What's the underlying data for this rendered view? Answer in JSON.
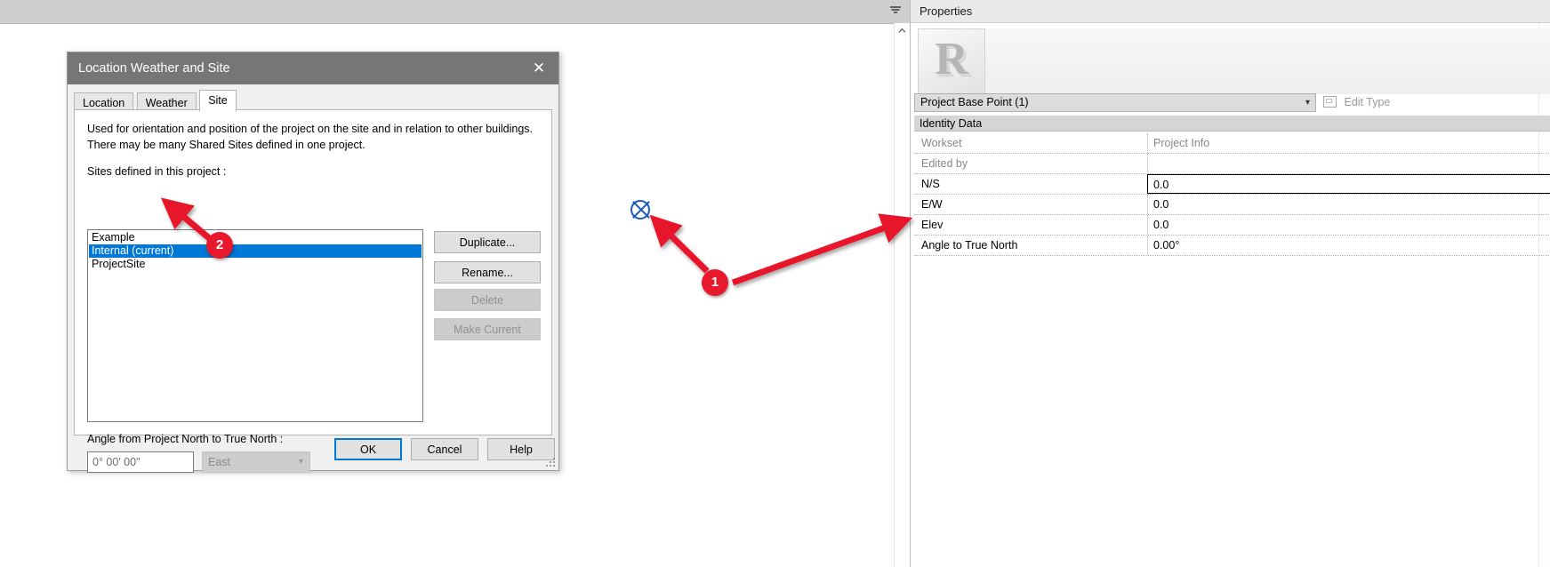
{
  "window": {
    "collapse_icon": "collapse-arrow-icon",
    "scroll_up_icon": "chevron-up-icon"
  },
  "dialog": {
    "title": "Location Weather and Site",
    "close_icon": "close-icon",
    "tabs": [
      {
        "label": "Location",
        "active": false
      },
      {
        "label": "Weather",
        "active": false
      },
      {
        "label": "Site",
        "active": true
      }
    ],
    "description": "Used for orientation and position of the project on the site and in relation to other buildings. There may be many Shared Sites defined in one project.",
    "sites_label": "Sites defined in this project :",
    "sites": [
      {
        "label": "Example",
        "selected": false
      },
      {
        "label": "Internal (current)",
        "selected": true
      },
      {
        "label": "ProjectSite",
        "selected": false
      }
    ],
    "side_buttons": [
      {
        "label": "Duplicate...",
        "disabled": false
      },
      {
        "label": "Rename...",
        "disabled": false
      },
      {
        "label": "Delete",
        "disabled": true
      },
      {
        "label": "Make Current",
        "disabled": true
      }
    ],
    "angle_label": "Angle from Project North to True North :",
    "angle_value": "0° 00' 00\"",
    "angle_direction": "East",
    "direction_caret_icon": "chevron-down-icon",
    "footer": {
      "ok": "OK",
      "cancel": "Cancel",
      "help": "Help"
    },
    "resize_grip_icon": "resize-grip-icon"
  },
  "canvas": {
    "base_point_icon": "project-base-point-marker-icon"
  },
  "properties": {
    "header": "Properties",
    "collapse_icon": "chevron-up-icon",
    "thumbnail_icon": "revit-r-logo-icon",
    "thumbnail_glyph": "R",
    "type_selector": "Project Base Point (1)",
    "type_caret_icon": "chevron-down-icon",
    "edit_type_label": "Edit Type",
    "edit_type_icon": "edit-type-icon",
    "group_header": "Identity Data",
    "rows": [
      {
        "name": "Workset",
        "value": "Project Info",
        "muted": true,
        "focused": false
      },
      {
        "name": "Edited by",
        "value": "",
        "muted": true,
        "focused": false
      },
      {
        "name": "N/S",
        "value": "0.0",
        "muted": false,
        "focused": true
      },
      {
        "name": "E/W",
        "value": "0.0",
        "muted": false,
        "focused": false
      },
      {
        "name": "Elev",
        "value": "0.0",
        "muted": false,
        "focused": false
      },
      {
        "name": "Angle to True North",
        "value": "0.00°",
        "muted": false,
        "focused": false
      }
    ],
    "scroll_up_icon": "chevron-up-icon",
    "scroll_down_icon": "chevron-down-icon"
  },
  "annotations": {
    "accent_color": "#e8192c",
    "markers": [
      {
        "id": "1",
        "label": "1"
      },
      {
        "id": "2",
        "label": "2"
      }
    ]
  },
  "colors": {
    "selection_blue": "#0078d7",
    "title_bar_gray": "#767676",
    "base_point_blue": "#1a55c8"
  }
}
